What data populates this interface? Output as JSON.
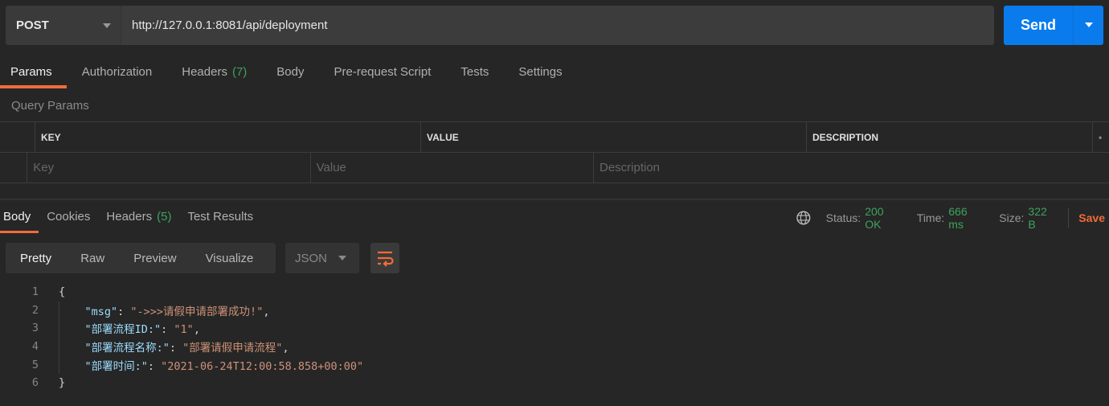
{
  "request": {
    "method": "POST",
    "url": "http://127.0.0.1:8081/api/deployment",
    "send_label": "Send"
  },
  "request_tabs": [
    {
      "label": "Params",
      "active": true
    },
    {
      "label": "Authorization"
    },
    {
      "label": "Headers",
      "count": "(7)"
    },
    {
      "label": "Body"
    },
    {
      "label": "Pre-request Script"
    },
    {
      "label": "Tests"
    },
    {
      "label": "Settings"
    }
  ],
  "query_params": {
    "title": "Query Params",
    "columns": [
      "KEY",
      "VALUE",
      "DESCRIPTION"
    ],
    "placeholders": [
      "Key",
      "Value",
      "Description"
    ]
  },
  "response_tabs": [
    {
      "label": "Body",
      "active": true
    },
    {
      "label": "Cookies"
    },
    {
      "label": "Headers",
      "count": "(5)"
    },
    {
      "label": "Test Results"
    }
  ],
  "status": {
    "status_label": "Status:",
    "status_value": "200 OK",
    "time_label": "Time:",
    "time_value": "666 ms",
    "size_label": "Size:",
    "size_value": "322 B",
    "save_label": "Save"
  },
  "view_modes": [
    "Pretty",
    "Raw",
    "Preview",
    "Visualize"
  ],
  "format": "JSON",
  "colors": {
    "accent": "#f26b3a",
    "send": "#097bed",
    "success": "#3da35d",
    "json_key": "#9cdcfe",
    "json_string": "#ce9178"
  },
  "code_lines": [
    {
      "n": "1",
      "parts": [
        [
          "p",
          "{"
        ]
      ]
    },
    {
      "n": "2",
      "parts": [
        [
          "p",
          "    "
        ],
        [
          "k",
          "\"msg\""
        ],
        [
          "p",
          ": "
        ],
        [
          "s",
          "\"->>>请假申请部署成功!\""
        ],
        [
          "p",
          ","
        ]
      ]
    },
    {
      "n": "3",
      "parts": [
        [
          "p",
          "    "
        ],
        [
          "k",
          "\"部署流程ID:\""
        ],
        [
          "p",
          ": "
        ],
        [
          "s",
          "\"1\""
        ],
        [
          "p",
          ","
        ]
      ]
    },
    {
      "n": "4",
      "parts": [
        [
          "p",
          "    "
        ],
        [
          "k",
          "\"部署流程名称:\""
        ],
        [
          "p",
          ": "
        ],
        [
          "s",
          "\"部署请假申请流程\""
        ],
        [
          "p",
          ","
        ]
      ]
    },
    {
      "n": "5",
      "parts": [
        [
          "p",
          "    "
        ],
        [
          "k",
          "\"部署时间:\""
        ],
        [
          "p",
          ": "
        ],
        [
          "s",
          "\"2021-06-24T12:00:58.858+00:00\""
        ]
      ]
    },
    {
      "n": "6",
      "parts": [
        [
          "p",
          "}"
        ]
      ]
    }
  ]
}
